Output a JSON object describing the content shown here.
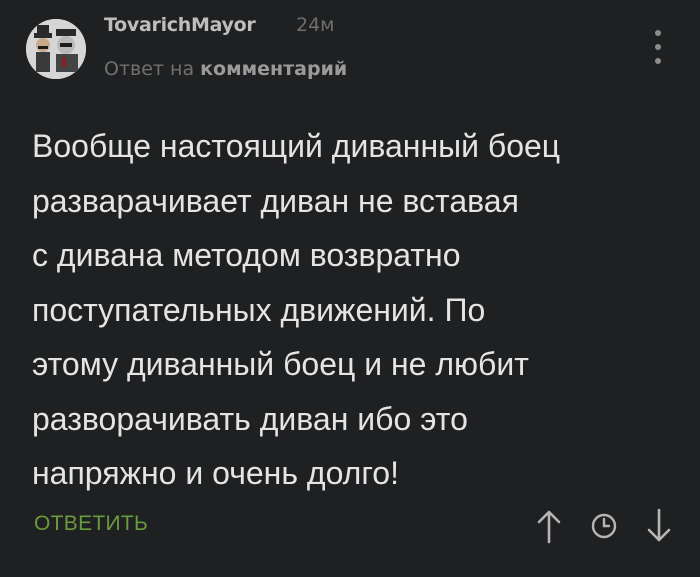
{
  "comment": {
    "author": "TovarichMayor",
    "time": "24м",
    "reply_prefix": "Ответ на",
    "reply_target": "комментарий",
    "lines": [
      "Вообще настоящий диванный боец",
      "разварачивает диван не вставая",
      "с дивана методом возвратно",
      "поступательных движений. По",
      "этому диванный боец и не любит",
      "разворачивать диван ибо это",
      "напряжно и очень долго!"
    ],
    "reply_button": "ОТВЕТИТЬ"
  },
  "icons": {
    "more": "more-vertical-icon",
    "upvote": "arrow-up-icon",
    "save": "clock-save-icon",
    "downvote": "arrow-down-icon"
  },
  "colors": {
    "background": "#1f2021",
    "text": "#e4e4e4",
    "accent_green": "#6a9a3e",
    "muted": "#707070"
  }
}
